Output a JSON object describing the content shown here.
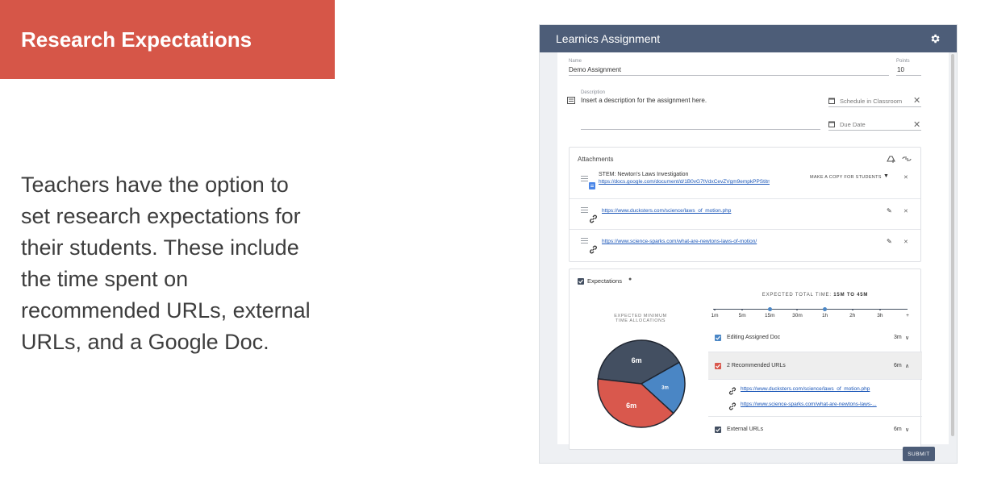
{
  "slide": {
    "title": "Research Expectations",
    "body": "Teachers have the option to set research expectations for their students. These include the time spent on recommended URLs, external URLs, and a Google Doc.",
    "header_color": "#d65648"
  },
  "app": {
    "title": "Learnics Assignment",
    "name_label": "Name",
    "name_value": "Demo Assignment",
    "points_label": "Points",
    "points_value": "10",
    "description_label": "Description",
    "description_value": "Insert a description for the assignment here.",
    "schedule_label": "Schedule in Classroom",
    "due_date_label": "Due Date",
    "attachments_title": "Attachments",
    "attachments": [
      {
        "title": "STEM: Newton's Laws Investigation",
        "url": "https://docs.google.com/document/d/1B0vG7tVdxCevZVgm9empkPPStitnjBFXh...",
        "action": "MAKE A COPY FOR STUDENTS",
        "icon": "google-doc-icon"
      },
      {
        "url": "https://www.ducksters.com/science/laws_of_motion.php",
        "icon": "link-icon"
      },
      {
        "url": "https://www.science-sparks.com/what-are-newtons-laws-of-motion/",
        "icon": "link-icon"
      }
    ],
    "expectations_label": "Expectations",
    "expected_total_prefix": "EXPECTED TOTAL TIME:",
    "expected_total_value": "15M TO 45M",
    "pie_title_line1": "EXPECTED MINIMUM",
    "pie_title_line2": "TIME ALLOCATIONS",
    "pie_slices": [
      {
        "label": "6m",
        "value": 6,
        "color": "#434f61"
      },
      {
        "label": "3m",
        "value": 3,
        "color": "#4a86c5"
      },
      {
        "label": "6m",
        "value": 6,
        "color": "#d9584d"
      }
    ],
    "time_ticks": [
      "1m",
      "5m",
      "15m",
      "30m",
      "1h",
      "2h",
      "3h",
      "+"
    ],
    "range_selected": [
      "15m",
      "1h"
    ],
    "expectation_rows": [
      {
        "label": "Editing Assigned Doc",
        "time": "3m",
        "chevron": "∨",
        "color": "#4a86c5"
      },
      {
        "label": "2 Recommended URLs",
        "time": "6m",
        "chevron": "∧",
        "color": "#d9584d"
      },
      {
        "label": "External URLs",
        "time": "6m",
        "chevron": "∨",
        "color": "#434f61"
      }
    ],
    "recommended_urls": [
      "https://www.ducksters.com/science/laws_of_motion.php",
      "https://www.science-sparks.com/what-are-newtons-laws-..."
    ],
    "submit_label": "SUBMIT"
  }
}
